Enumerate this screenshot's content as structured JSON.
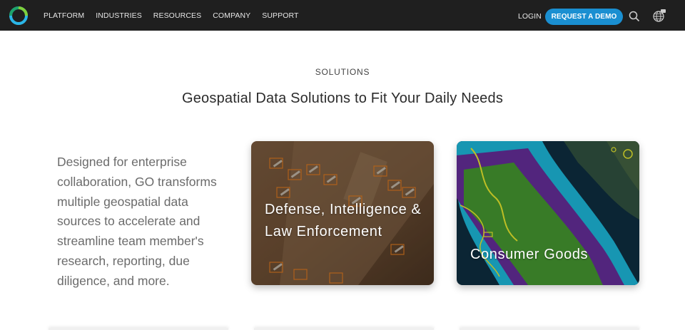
{
  "nav": {
    "logo_icon": "ring-logo-icon",
    "links": [
      "PLATFORM",
      "INDUSTRIES",
      "RESOURCES",
      "COMPANY",
      "SUPPORT"
    ],
    "login_label": "LOGIN",
    "demo_label": "REQUEST A DEMO",
    "search_icon": "search-icon",
    "globe_icon": "globe-icon"
  },
  "section": {
    "eyebrow": "SOLUTIONS",
    "headline": "Geospatial Data Solutions to Fit Your Daily Needs",
    "description": "Designed for enterprise collaboration, GO transforms multiple geospatial data sources to accelerate and streamline team member's research, reporting, due diligence, and more."
  },
  "cards": [
    {
      "title": "Defense, Intelligence & Law Enforcement"
    },
    {
      "title": "Consumer Goods"
    }
  ],
  "colors": {
    "nav_bg": "#1f1f1f",
    "accent": "#1a8fd1"
  }
}
